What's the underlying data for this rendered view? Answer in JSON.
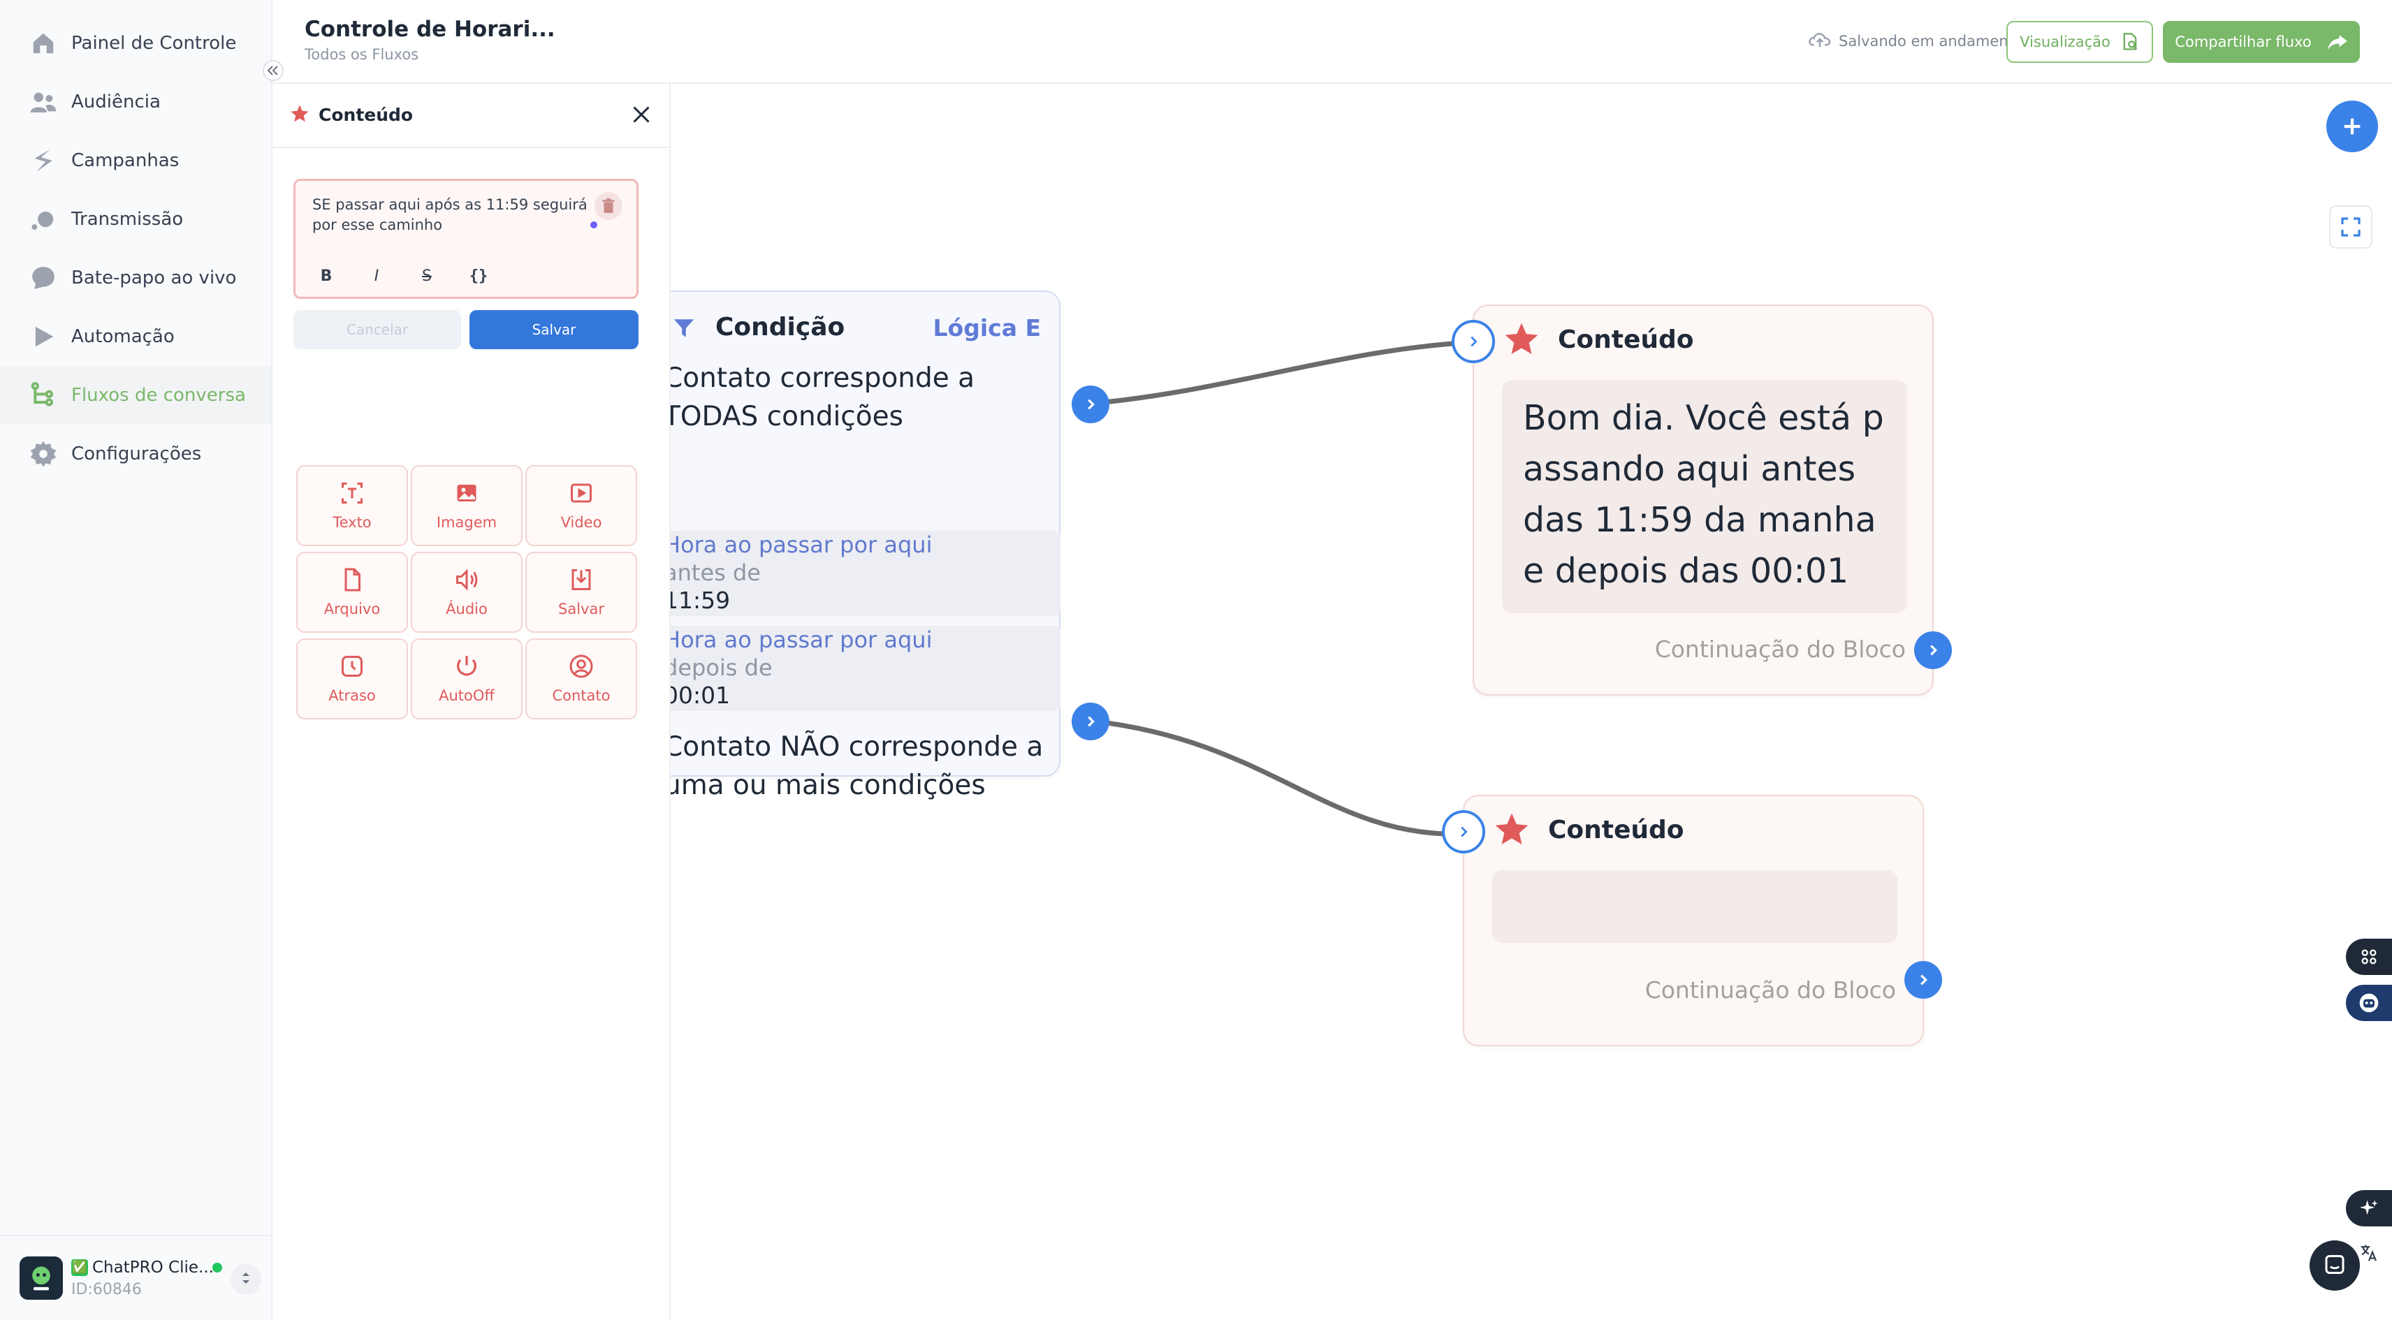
{
  "sidebar": {
    "items": [
      {
        "label": "Painel de Controle",
        "icon": "home-icon"
      },
      {
        "label": "Audiência",
        "icon": "users-icon"
      },
      {
        "label": "Campanhas",
        "icon": "campaign-icon"
      },
      {
        "label": "Transmissão",
        "icon": "broadcast-icon"
      },
      {
        "label": "Bate-papo ao vivo",
        "icon": "chat-icon"
      },
      {
        "label": "Automação",
        "icon": "automation-icon"
      },
      {
        "label": "Fluxos de conversa",
        "icon": "flow-icon",
        "active": true
      },
      {
        "label": "Configurações",
        "icon": "gear-icon"
      }
    ],
    "account": {
      "check": "✅",
      "name": "ChatPRO Clie...",
      "id": "ID:60846"
    }
  },
  "header": {
    "title": "Controle de Horari...",
    "breadcrumb": "Todos os Fluxos",
    "saving_status": "Salvando em andamento",
    "preview_label": "Visualização",
    "share_label": "Compartilhar fluxo"
  },
  "panel": {
    "title": "Conteúdo",
    "editor_text": "SE passar aqui após as 11:59 seguirá por esse caminho",
    "format_buttons": [
      "B",
      "I",
      "S",
      "{}"
    ],
    "cancel_label": "Cancelar",
    "save_label": "Salvar",
    "tools": [
      "Texto",
      "Imagem",
      "Video",
      "Arquivo",
      "Áudio",
      "Salvar",
      "Atraso",
      "AutoOff",
      "Contato"
    ]
  },
  "condition_node": {
    "title": "Condição",
    "logic": "Lógica E",
    "match_all_text": "Contato corresponde a TODAS condições",
    "conditions": [
      {
        "label": "Hora ao passar por aqui",
        "operator": "antes de",
        "value": "11:59"
      },
      {
        "label": "Hora ao passar por aqui",
        "operator": "depois de",
        "value": "00:01"
      }
    ],
    "no_match_text": "Contato NÃO corresponde a uma ou mais condições"
  },
  "content_nodes": [
    {
      "title": "Conteúdo",
      "message": "Bom dia. Você está passando aqui antes das 11:59 da manha e depois das 00:01",
      "continuation": "Continuação do Bloco"
    },
    {
      "title": "Conteúdo",
      "message": "",
      "continuation": "Continuação do Bloco"
    }
  ],
  "colors": {
    "accent_green": "#7ab86a",
    "primary_blue": "#3b82e8",
    "content_red": "#e05a5a",
    "logic_blue": "#5f7bd6"
  }
}
